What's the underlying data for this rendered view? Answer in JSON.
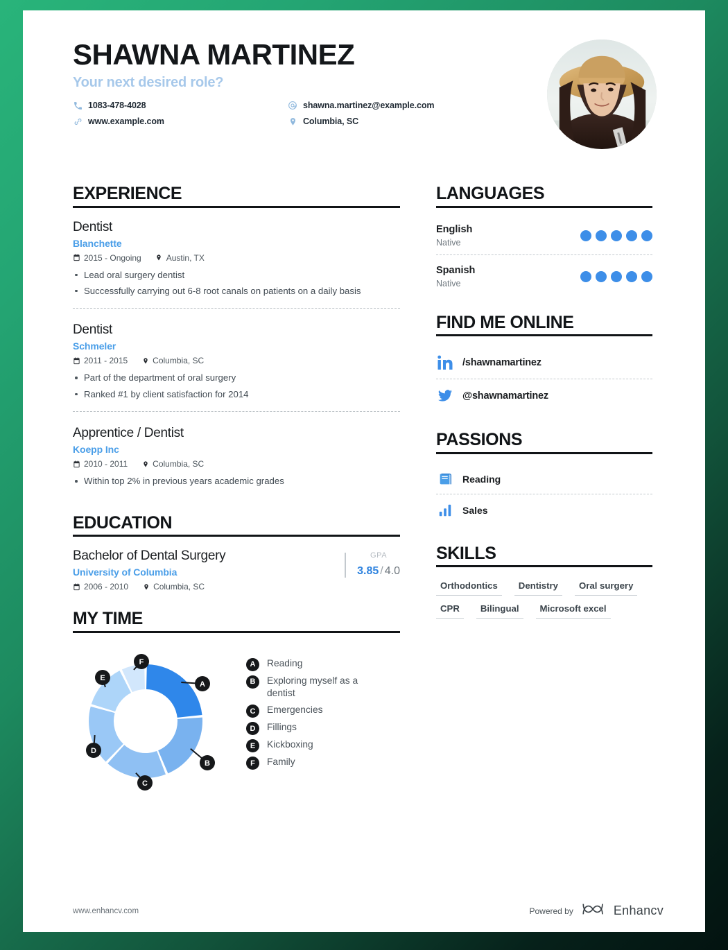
{
  "header": {
    "name": "SHAWNA MARTINEZ",
    "role": "Your next desired role?",
    "contacts": [
      {
        "icon": "phone-icon",
        "text": "1083-478-4028"
      },
      {
        "icon": "email-icon",
        "text": "shawna.martinez@example.com"
      },
      {
        "icon": "link-icon",
        "text": "www.example.com"
      },
      {
        "icon": "location-pin-icon",
        "text": "Columbia, SC"
      }
    ],
    "photo_alt": "portrait-photo"
  },
  "experience": {
    "title": "EXPERIENCE",
    "entries": [
      {
        "job_title": "Dentist",
        "company": "Blanchette",
        "dates": "2015 - Ongoing",
        "location": "Austin, TX",
        "bullets": [
          "Lead oral surgery dentist",
          "Successfully carrying out 6-8 root canals on patients on a daily basis"
        ]
      },
      {
        "job_title": "Dentist",
        "company": "Schmeler",
        "dates": "2011 - 2015",
        "location": "Columbia, SC",
        "bullets": [
          "Part of the department of oral surgery",
          "Ranked #1 by client satisfaction for 2014"
        ]
      },
      {
        "job_title": "Apprentice / Dentist",
        "company": "Koepp Inc",
        "dates": "2010 - 2011",
        "location": "Columbia, SC",
        "bullets": [
          "Within top 2% in previous years academic grades"
        ]
      }
    ]
  },
  "education": {
    "title": "EDUCATION",
    "entries": [
      {
        "degree": "Bachelor of Dental Surgery",
        "school": "University of Columbia",
        "dates": "2006 - 2010",
        "location": "Columbia, SC",
        "gpa_label": "GPA",
        "gpa_value": "3.85",
        "gpa_separator": "/",
        "gpa_max": "4.0"
      }
    ]
  },
  "languages": {
    "title": "LANGUAGES",
    "items": [
      {
        "name": "English",
        "level": "Native",
        "filled": 5,
        "total": 5
      },
      {
        "name": "Spanish",
        "level": "Native",
        "filled": 5,
        "total": 5
      }
    ]
  },
  "find_me_online": {
    "title": "FIND ME ONLINE",
    "items": [
      {
        "icon": "linkedin-icon",
        "label": "/shawnamartinez"
      },
      {
        "icon": "twitter-icon",
        "label": "@shawnamartinez"
      }
    ]
  },
  "passions": {
    "title": "PASSIONS",
    "items": [
      {
        "icon": "book-icon",
        "label": "Reading"
      },
      {
        "icon": "bar-chart-icon",
        "label": "Sales"
      }
    ]
  },
  "skills": {
    "title": "SKILLS",
    "items": [
      "Orthodontics",
      "Dentistry",
      "Oral surgery",
      "CPR",
      "Bilingual",
      "Microsoft excel"
    ]
  },
  "my_time": {
    "title": "MY TIME"
  },
  "chart_data": {
    "type": "pie",
    "title": "MY TIME",
    "chart_style": "donut",
    "legend_position": "right",
    "categories": [
      "Reading",
      "Exploring myself as a dentist",
      "Emergencies",
      "Fillings",
      "Kickboxing",
      "Family"
    ],
    "labels": [
      "A",
      "B",
      "C",
      "D",
      "E",
      "F"
    ],
    "values": [
      23.6,
      20.3,
      18.1,
      17.5,
      13.3,
      7.2
    ],
    "units": "percent",
    "colors": [
      "#2f87ea",
      "#79b2ef",
      "#8fc0f3",
      "#9ac8f6",
      "#add5f9",
      "#d2e7fc"
    ],
    "start_angle_deg": 0,
    "direction": "clockwise"
  },
  "footer": {
    "url": "www.enhancv.com",
    "powered_by": "Powered by",
    "brand": "Enhancv"
  },
  "colors": {
    "accent_blue": "#3d8ee8",
    "company_blue": "#4a9ee8",
    "role_blue": "#a6c8ea",
    "heading_black": "#111417",
    "background_green": "#29b47a"
  }
}
